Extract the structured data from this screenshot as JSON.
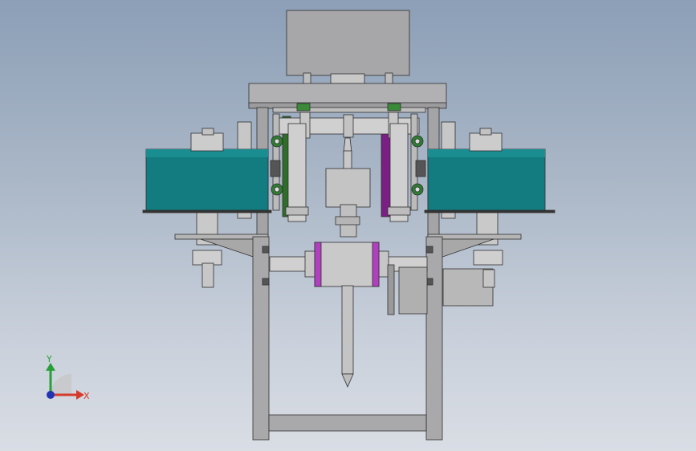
{
  "viewport": {
    "name": "cad-model-viewport",
    "background_top": "#8c9fb7",
    "background_bottom": "#d9dde4"
  },
  "model": {
    "description_icon": "machine-assembly-icon",
    "colors": {
      "frame": "#a9a9ab",
      "drum": "#127c80",
      "purple_panel": "#7a1f83",
      "green_panel": "#2f6d2a",
      "magenta_ring": "#b040c0",
      "steel": "#c9c9c9",
      "dark_outline": "#303030"
    }
  },
  "triad": {
    "y_label": "Y",
    "x_label": "X",
    "y_color": "#27a03a",
    "x_color": "#d53a2b",
    "z_color": "#2233b3"
  }
}
